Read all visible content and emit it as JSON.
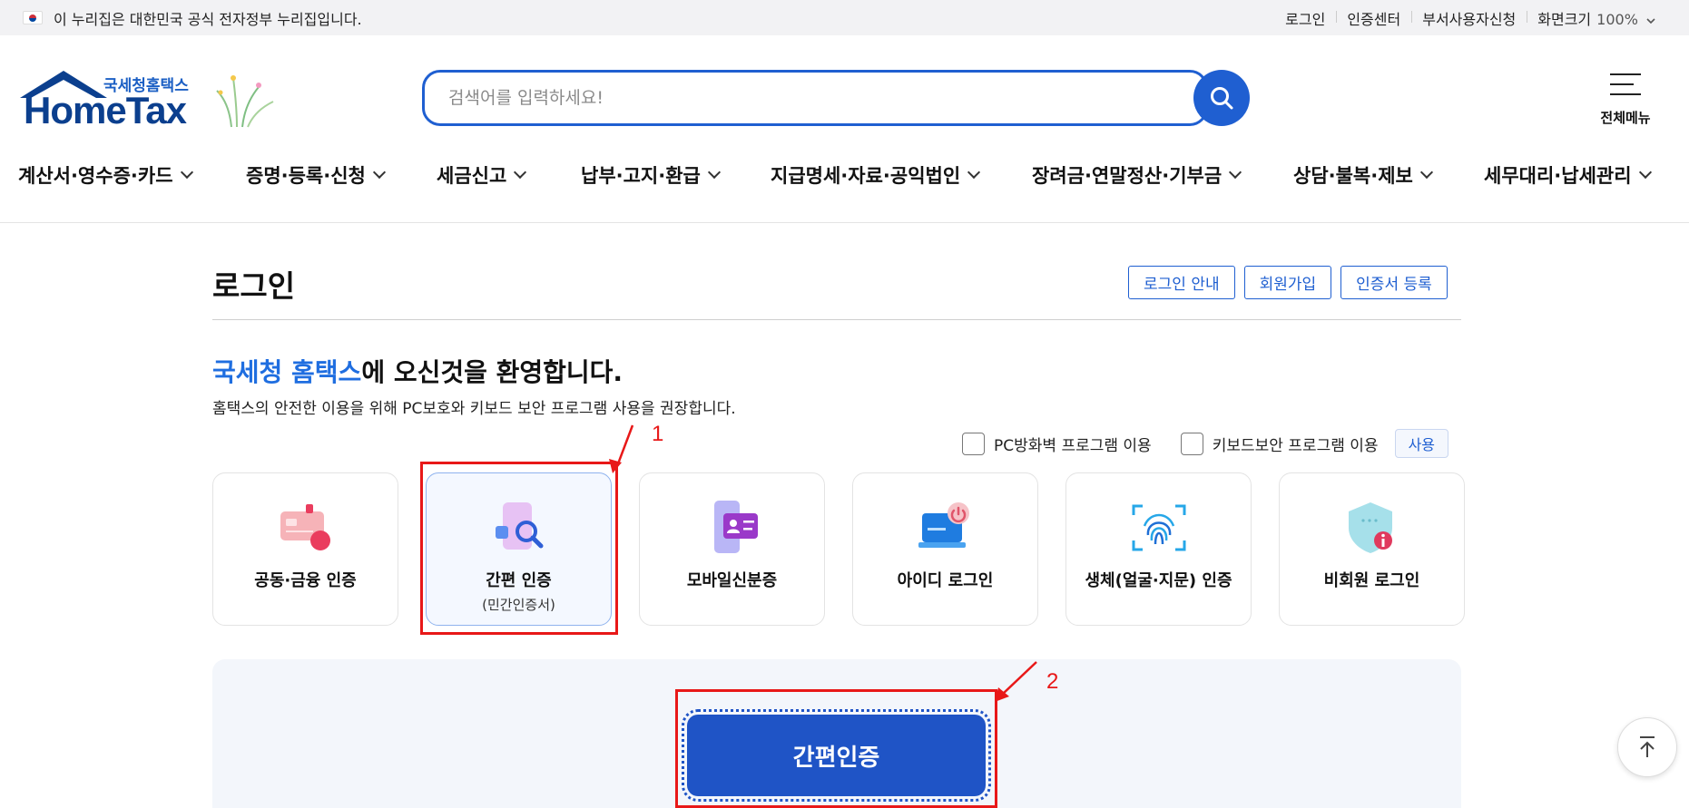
{
  "gov_banner": {
    "notice": "이 누리집은 대한민국 공식 전자정부 누리집입니다.",
    "links": [
      "로그인",
      "인증센터",
      "부서사용자신청"
    ],
    "zoom_label": "화면크기",
    "zoom_value": "100%"
  },
  "logo": {
    "tag": "국세청홈택스",
    "word": "HomeTax"
  },
  "search": {
    "placeholder": "검색어를 입력하세요!"
  },
  "all_menu_label": "전체메뉴",
  "gnb": [
    "계산서·영수증·카드",
    "증명·등록·신청",
    "세금신고",
    "납부·고지·환급",
    "지급명세·자료·공익법인",
    "장려금·연말정산·기부금",
    "상담·불복·제보",
    "세무대리·납세관리"
  ],
  "page": {
    "title": "로그인",
    "buttons": [
      "로그인 안내",
      "회원가입",
      "인증서 등록"
    ],
    "welcome_brand": "국세청 홈택스",
    "welcome_rest": "에 오신것을 환영합니다.",
    "subtitle": "홈택스의 안전한 이용을 위해 PC보호와 키보드 보안 프로그램 사용을 권장합니다.",
    "options": [
      "PC방화벽 프로그램 이용",
      "키보드보안 프로그램 이용"
    ],
    "use_button": "사용"
  },
  "login_methods": [
    {
      "label": "공동·금융 인증",
      "sub": "",
      "icon": "certificate-card-icon"
    },
    {
      "label": "간편 인증",
      "sub": "(민간인증서)",
      "icon": "simple-auth-icon",
      "selected": true
    },
    {
      "label": "모바일신분증",
      "sub": "",
      "icon": "mobile-id-icon"
    },
    {
      "label": "아이디 로그인",
      "sub": "",
      "icon": "id-login-icon"
    },
    {
      "label": "생체(얼굴·지문) 인증",
      "sub": "",
      "icon": "fingerprint-icon"
    },
    {
      "label": "비회원 로그인",
      "sub": "",
      "icon": "guest-shield-icon"
    }
  ],
  "main_button": "간편인증",
  "annotations": [
    "1",
    "2"
  ],
  "colors": {
    "primary": "#1f5fd1",
    "annotation": "#e81818"
  }
}
